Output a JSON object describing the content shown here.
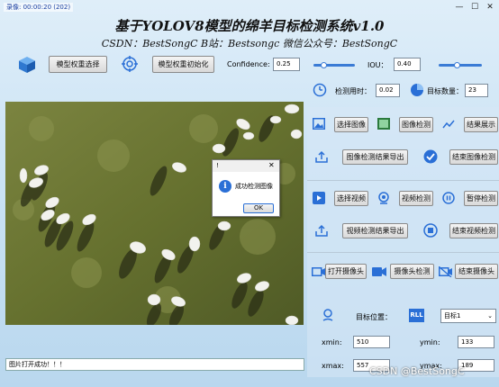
{
  "window": {
    "rec_time": "录像: 00:00:20 (202)",
    "minimize_glyph": "—",
    "maximize_glyph": "☐",
    "close_glyph": "✕"
  },
  "app_title": "基于YOLOV8模型的绵羊目标检测系统v1.0",
  "subtitle": "CSDN：BestSongC   B站：Bestsongc   微信公众号：BestSongC",
  "toolbar": {
    "model_select": "模型权重选择",
    "model_init": "模型权重初始化",
    "confidence_label": "Confidence:",
    "confidence_value": "0.25",
    "iou_label": "IOU：",
    "iou_value": "0.40"
  },
  "stats": {
    "time_label": "检测用时：",
    "time_value": "0.02",
    "count_label": "目标数量：",
    "count_value": "23"
  },
  "buttons": {
    "select_image": "选择图像",
    "image_detect": "图像检测",
    "show_result": "结果展示",
    "export_image": "图像检测结果导出",
    "end_image": "结束图像检测",
    "select_video": "选择视频",
    "video_detect": "视频检测",
    "pause_detect": "暂停检测",
    "export_video": "视频检测结果导出",
    "end_video": "结束视频检测",
    "open_camera": "打开摄像头",
    "camera_detect": "摄像头检测",
    "end_camera": "结束摄像头"
  },
  "target": {
    "label": "目标位置：",
    "selected": "目标1",
    "xmin_label": "xmin:",
    "xmin_value": "510",
    "ymin_label": "ymin:",
    "ymin_value": "133",
    "xmax_label": "xmax:",
    "xmax_value": "557",
    "ymax_label": "ymax:",
    "ymax_value": "189"
  },
  "dialog": {
    "title": "!",
    "message": "成功检测图像",
    "ok": "OK",
    "close_glyph": "✕"
  },
  "status_message": "图片打开成功！！！",
  "watermark": "CSDN @BestSongC",
  "colors": {
    "accent": "#2a6fd6",
    "background": "#cde4f5",
    "grass": "#6b7536",
    "sheep": "#f2f2ee"
  }
}
